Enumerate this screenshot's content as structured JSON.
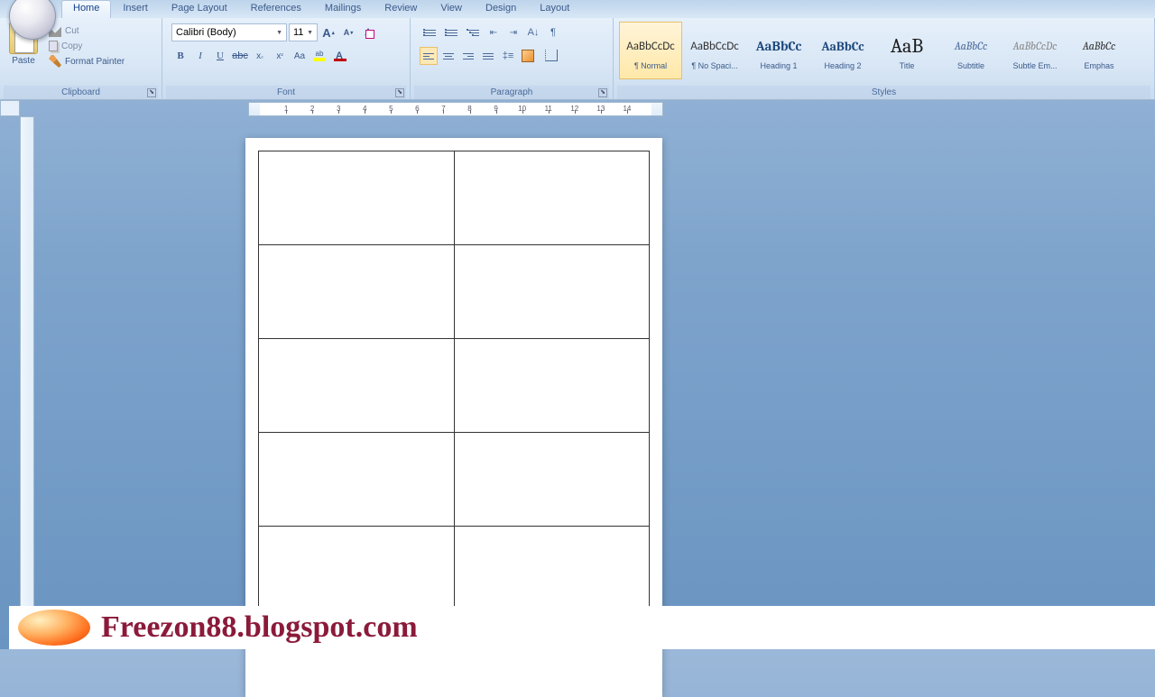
{
  "tabs": {
    "home": "Home",
    "insert": "Insert",
    "page_layout": "Page Layout",
    "references": "References",
    "mailings": "Mailings",
    "review": "Review",
    "view": "View",
    "design": "Design",
    "layout": "Layout"
  },
  "clipboard": {
    "paste": "Paste",
    "cut": "Cut",
    "copy": "Copy",
    "format_painter": "Format Painter",
    "group_label": "Clipboard"
  },
  "font": {
    "name": "Calibri (Body)",
    "size": "11",
    "group_label": "Font"
  },
  "paragraph": {
    "group_label": "Paragraph"
  },
  "styles": {
    "group_label": "Styles",
    "items": [
      {
        "preview": "AaBbCcDc",
        "label": "¶ Normal",
        "cls": "sp-normal",
        "active": true
      },
      {
        "preview": "AaBbCcDc",
        "label": "¶ No Spaci...",
        "cls": "sp-normal"
      },
      {
        "preview": "AaBbCc",
        "label": "Heading 1",
        "cls": "sp-heading1"
      },
      {
        "preview": "AaBbCc",
        "label": "Heading 2",
        "cls": "sp-heading2"
      },
      {
        "preview": "AaB",
        "label": "Title",
        "cls": "sp-title"
      },
      {
        "preview": "AaBbCc",
        "label": "Subtitle",
        "cls": "sp-subtitle"
      },
      {
        "preview": "AaBbCcDc",
        "label": "Subtle Em...",
        "cls": "sp-subtle"
      },
      {
        "preview": "AaBbCc",
        "label": "Emphas",
        "cls": "sp-emphasis"
      }
    ]
  },
  "ruler": {
    "marks": [
      1,
      2,
      3,
      4,
      5,
      6,
      7,
      8,
      9,
      10,
      11,
      12,
      13,
      14
    ]
  },
  "banner": {
    "text": "Freezon88.blogspot.com"
  }
}
